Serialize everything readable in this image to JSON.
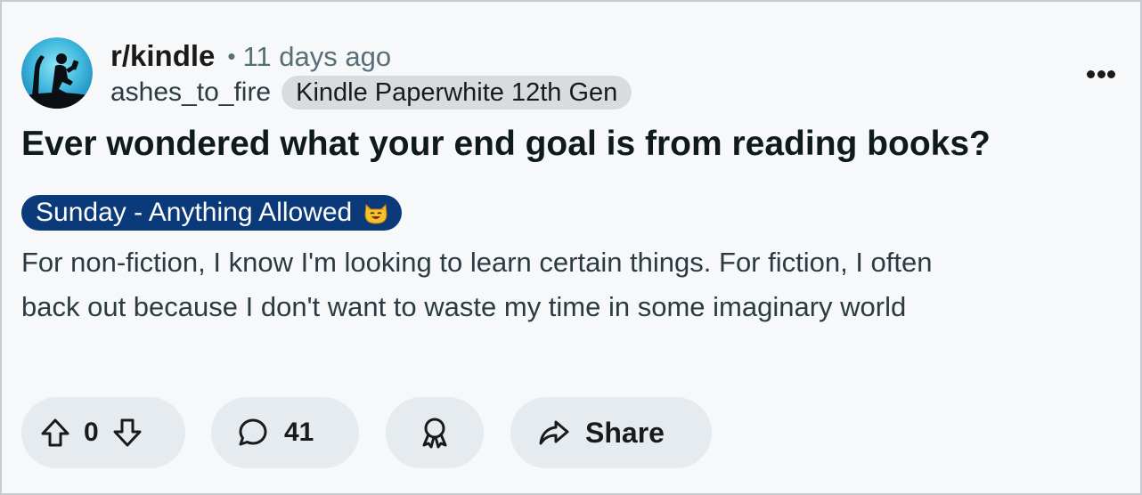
{
  "post": {
    "subreddit": "r/kindle",
    "separator": "•",
    "age": "11 days ago",
    "username": "ashes_to_fire",
    "user_flair": "Kindle Paperwhite 12th Gen",
    "title": "Ever wondered what your end goal is from reading books?",
    "post_flair": "Sunday - Anything Allowed",
    "post_flair_emoji": "cat-smile-icon",
    "body_lines": [
      "For non-fiction, I know I'm looking to learn certain things. For fiction, I often",
      "back out because I don't want to waste my time in some imaginary world"
    ]
  },
  "actions": {
    "vote_count": "0",
    "comment_count": "41",
    "share_label": "Share"
  },
  "icons": {
    "avatar": "kindle-reader-avatar-icon",
    "more": "more-options-icon",
    "upvote": "upvote-arrow-icon",
    "downvote": "downvote-arrow-icon",
    "comment": "comment-bubble-icon",
    "award": "award-icon",
    "share": "share-arrow-icon"
  },
  "colors": {
    "background": "#f7f8f9",
    "flair_blue": "#0b3a7a",
    "user_flair_bg": "#d9dcdf",
    "pill_bg": "#e5ebee",
    "meta_grey": "#576f76"
  }
}
